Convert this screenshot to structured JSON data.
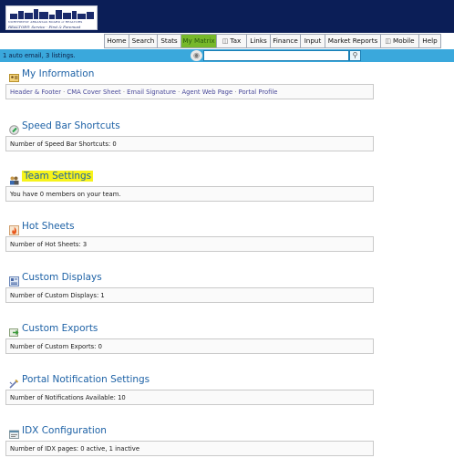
{
  "logo": {
    "org_text": "NORTHWEST ARKANSAS BOARD of REALTORS",
    "tagline": "REALTOR® Service - First & Foremost"
  },
  "nav": {
    "tabs": [
      {
        "label": "Home"
      },
      {
        "label": "Search"
      },
      {
        "label": "Stats"
      },
      {
        "label": "My Matrix",
        "active": true
      },
      {
        "label": "Tax",
        "icon": "window-icon"
      },
      {
        "label": "Links"
      },
      {
        "label": "Finance"
      },
      {
        "label": "Input"
      },
      {
        "label": "Market Reports"
      },
      {
        "label": "Mobile",
        "icon": "window-icon"
      },
      {
        "label": "Help"
      }
    ]
  },
  "status": {
    "text": "1 auto email, 3 listings.",
    "search_value": ""
  },
  "sections": [
    {
      "title": "My Information",
      "icon": "person-card-icon",
      "links": [
        "Header & Footer",
        "CMA Cover Sheet",
        "Email Signature",
        "Agent Web Page",
        "Portal Profile"
      ]
    },
    {
      "title": "Speed Bar Shortcuts",
      "icon": "speed-bar-icon",
      "text": "Number of Speed Bar Shortcuts: 0"
    },
    {
      "title": "Team Settings",
      "icon": "team-icon",
      "text": "You have 0 members on your team.",
      "highlight": true
    },
    {
      "title": "Hot Sheets",
      "icon": "flame-icon",
      "text": "Number of Hot Sheets: 3"
    },
    {
      "title": "Custom Displays",
      "icon": "display-icon",
      "text": "Number of Custom Displays: 1"
    },
    {
      "title": "Custom Exports",
      "icon": "export-icon",
      "text": "Number of Custom Exports: 0"
    },
    {
      "title": "Portal Notification Settings",
      "icon": "notification-icon",
      "text": "Number of Notifications Available: 10"
    },
    {
      "title": "IDX Configuration",
      "icon": "idx-icon",
      "text": "Number of IDX pages: 0 active, 1 inactive"
    }
  ],
  "colors": {
    "header_bg": "#0b1e57",
    "status_bg": "#3aa8dc",
    "active_tab": "#76b82a",
    "section_title": "#1e62a6",
    "highlight": "#f7f31a"
  }
}
